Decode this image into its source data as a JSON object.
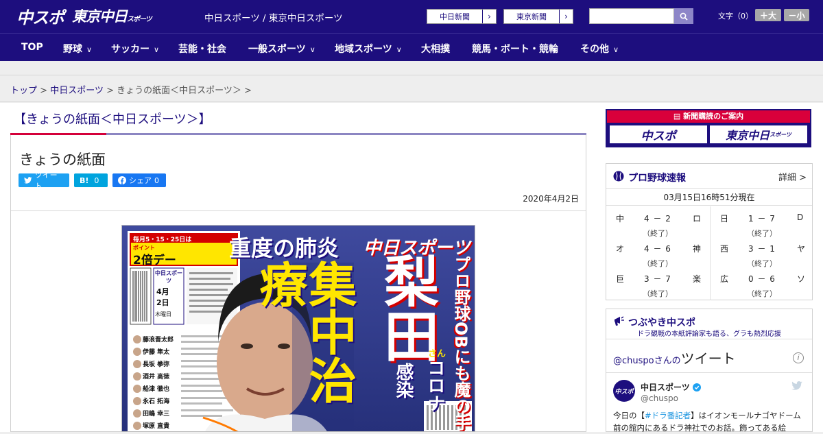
{
  "header": {
    "logo_primary": "中スポ",
    "logo_secondary": "東京中日",
    "logo_secondary_small": "スポーツ",
    "site_title": "中日スポーツ / 東京中日スポーツ",
    "link_chunichi": "中日新聞",
    "link_tokyo": "東京新聞",
    "font_size_label": "文字（0）",
    "font_plus": "＋大",
    "font_minus": "－小"
  },
  "nav": {
    "items": [
      {
        "label": "TOP"
      },
      {
        "label": "野球"
      },
      {
        "label": "サッカー"
      },
      {
        "label": "芸能・社会"
      },
      {
        "label": "一般スポーツ"
      },
      {
        "label": "地域スポーツ"
      },
      {
        "label": "大相撲"
      },
      {
        "label": "競馬・ボート・競輪"
      },
      {
        "label": "その他"
      }
    ]
  },
  "breadcrumb": {
    "items": [
      "トップ",
      "中日スポーツ",
      "きょうの紙面＜中日スポーツ＞"
    ],
    "sep": ">"
  },
  "page": {
    "heading": "【きょうの紙面＜中日スポーツ＞】"
  },
  "article": {
    "title": "きょうの紙面",
    "share_tweet": "ツイート",
    "share_hatena": "B!",
    "share_hatena_count": "0",
    "share_fb": "シェア",
    "share_fb_count": "0",
    "date": "2020年4月2日"
  },
  "newspaper": {
    "promo_top": "毎月5・15・25日は",
    "promo_main": "2倍デー",
    "promo_small": "ポイント",
    "masthead": "中日スポーツ",
    "date_month": "4月",
    "date_day": "2日",
    "weekday": "木曜日",
    "headline_small": "重度の肺炎",
    "headline_big1": "集中治療",
    "headline_big2": "梨田",
    "headline_side1": "プロ野球OBにも魔の手",
    "headline_side2": "コロナ",
    "headline_side3": "感染",
    "headline_san": "さん",
    "index_names": [
      "藤浪晋太郎",
      "伊藤 隼太",
      "長坂 拳弥",
      "酒井 高徳",
      "船津 徹也",
      "永石 拓海",
      "田嶋 幸三",
      "塚原 直貴"
    ]
  },
  "sidebar": {
    "ad_top": "新聞購読のご案内",
    "ad_left": "中スポ",
    "ad_right": "東京中日",
    "ad_right_small": "スポーツ",
    "scores": {
      "title": "プロ野球速報",
      "detail": "詳細 >",
      "time": "03月15日16時51分現在",
      "games": [
        {
          "home": "中",
          "score": "4 － 2",
          "away": "ロ",
          "status": "（終了）"
        },
        {
          "home": "日",
          "score": "1 － 7",
          "away": "D",
          "status": "（終了）"
        },
        {
          "home": "オ",
          "score": "4 － 6",
          "away": "神",
          "status": "（終了）"
        },
        {
          "home": "西",
          "score": "3 － 1",
          "away": "ヤ",
          "status": "（終了）"
        },
        {
          "home": "巨",
          "score": "3 － 7",
          "away": "楽",
          "status": "（終了）"
        },
        {
          "home": "広",
          "score": "0 － 6",
          "away": "ソ",
          "status": "（終了）"
        }
      ]
    },
    "tweets": {
      "title": "つぶやき中スポ",
      "subtitle": "ドラ観戦の本紙評論家も語る、グラも熱烈応援",
      "handle_line": "@chuspoさんの",
      "handle_big": "ツイート",
      "info": "i",
      "avatar_text": "中スポ",
      "name": "中日スポーツ",
      "handle": "@chuspo",
      "body_before": "今日の【",
      "body_tag": "#ドラ番記者",
      "body_after": "】はイオンモールナゴヤドーム前の館内にあるドラ神社でのお話。飾ってある絵"
    }
  }
}
